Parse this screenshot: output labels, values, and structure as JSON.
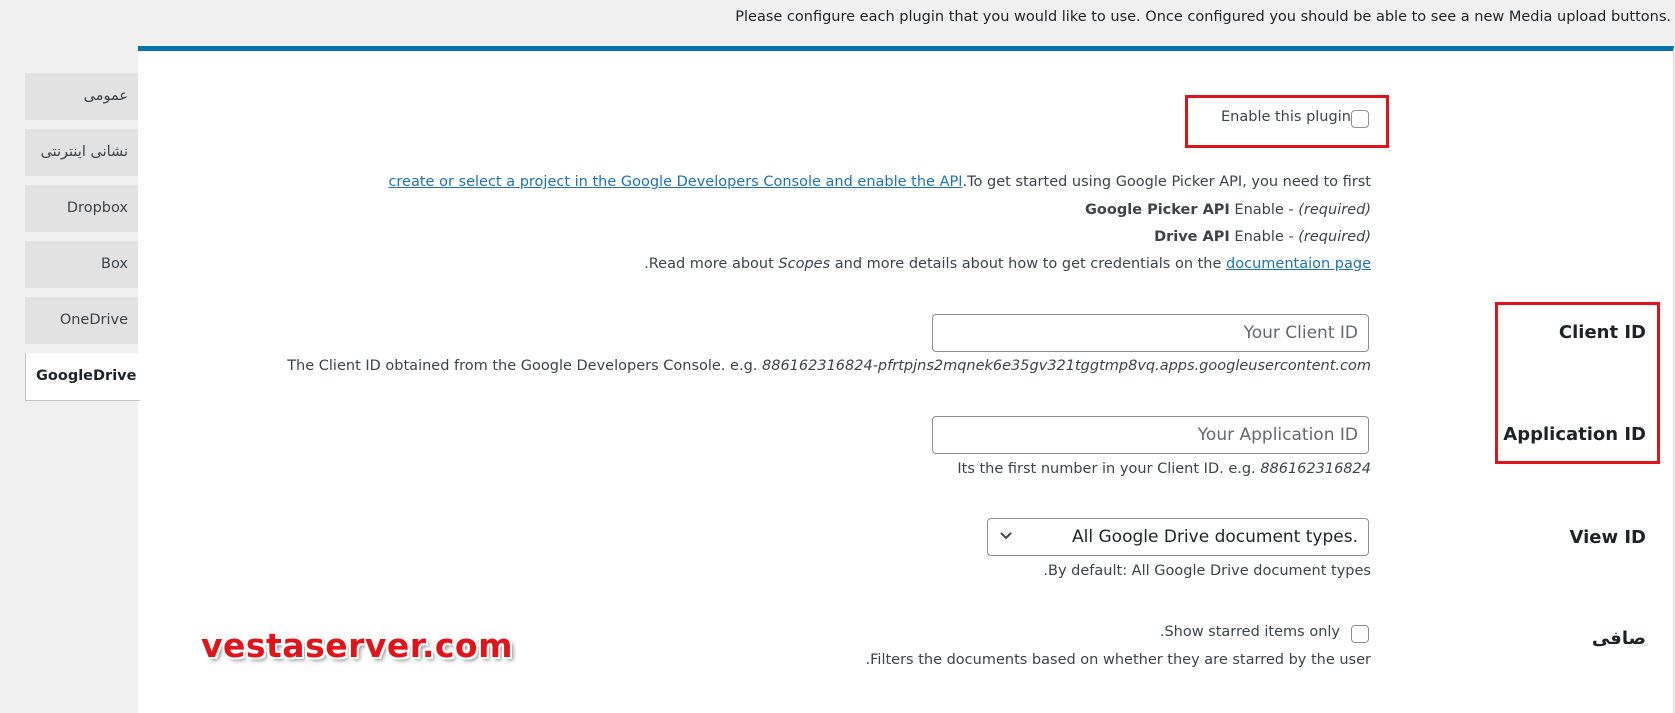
{
  "notice": ".Please configure each plugin that you would like to use. Once configured you should be able to see a new Media upload buttons",
  "tabs": [
    {
      "label": "عمومی"
    },
    {
      "label": "نشانی اینترنتی"
    },
    {
      "label": "Dropbox"
    },
    {
      "label": "Box"
    },
    {
      "label": "OneDrive"
    },
    {
      "label": "GoogleDrive",
      "active": true
    }
  ],
  "enable": {
    "label": "Enable this plugin",
    "checked": false
  },
  "intro": {
    "pre": ".To get started using Google Picker API, you need to first ",
    "link": "create or select a project in the Google Developers Console and enable the API",
    "picker_prefix": "Enable ",
    "picker_name": "Google Picker API",
    "picker_req": "(required) -",
    "drive_prefix": "Enable ",
    "drive_name": "Drive API",
    "drive_req": "(required) -",
    "read_pre": ".Read more about ",
    "read_scopes": "Scopes",
    "read_mid": " and more details about how to get credentials on the ",
    "read_link": "documentaion page"
  },
  "client_id": {
    "label": "Client ID",
    "placeholder": "Your Client ID",
    "desc_prefix": "The Client ID obtained from the Google Developers Console. e.g. ",
    "desc_example": "886162316824-pfrtpjns2mqnek6e35gv321tggtmp8vq.apps.googleusercontent.com"
  },
  "application_id": {
    "label": "Application ID",
    "placeholder": "Your Application ID",
    "desc_prefix": "Its the first number in your Client ID. e.g. ",
    "desc_example": "886162316824"
  },
  "view_id": {
    "label": "View ID",
    "selected": ".All Google Drive document types",
    "desc": ".By default: All Google Drive document types"
  },
  "filter": {
    "label": "صافی",
    "checkbox_label": ".Show starred items only",
    "checked": false,
    "desc": ".Filters the documents based on whether they are starred by the user"
  },
  "watermark": "vestaserver.com",
  "colors": {
    "accent": "#0073aa",
    "highlight": "#e2141b",
    "link": "#2271b1"
  }
}
